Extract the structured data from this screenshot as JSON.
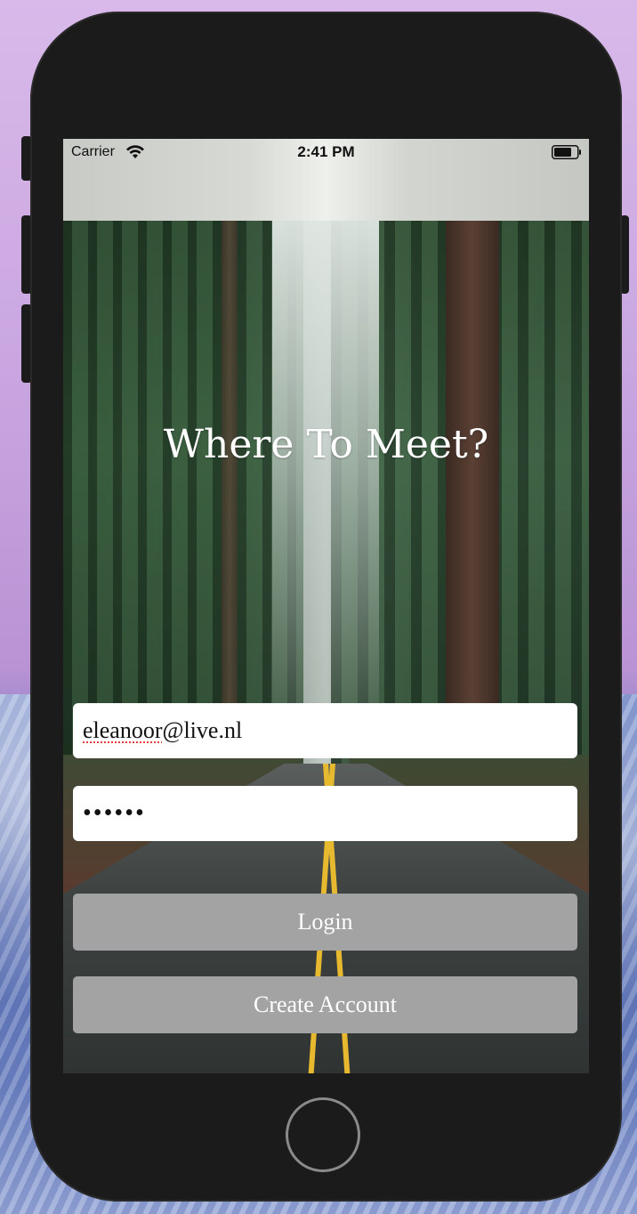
{
  "status_bar": {
    "carrier": "Carrier",
    "time": "2:41 PM",
    "wifi_icon": "wifi-icon",
    "battery_icon": "battery-icon"
  },
  "main": {
    "title": "Where To Meet?",
    "email_value": "eleanoor@live.nl",
    "email_username": "eleanoor",
    "email_domain": "@live.nl",
    "password_value": "••••••",
    "login_label": "Login",
    "create_account_label": "Create Account"
  },
  "colors": {
    "button_bg": "#a3a3a3",
    "field_bg": "#ffffff",
    "title_color": "#ffffff",
    "spellcheck_underline": "#e0403a"
  }
}
